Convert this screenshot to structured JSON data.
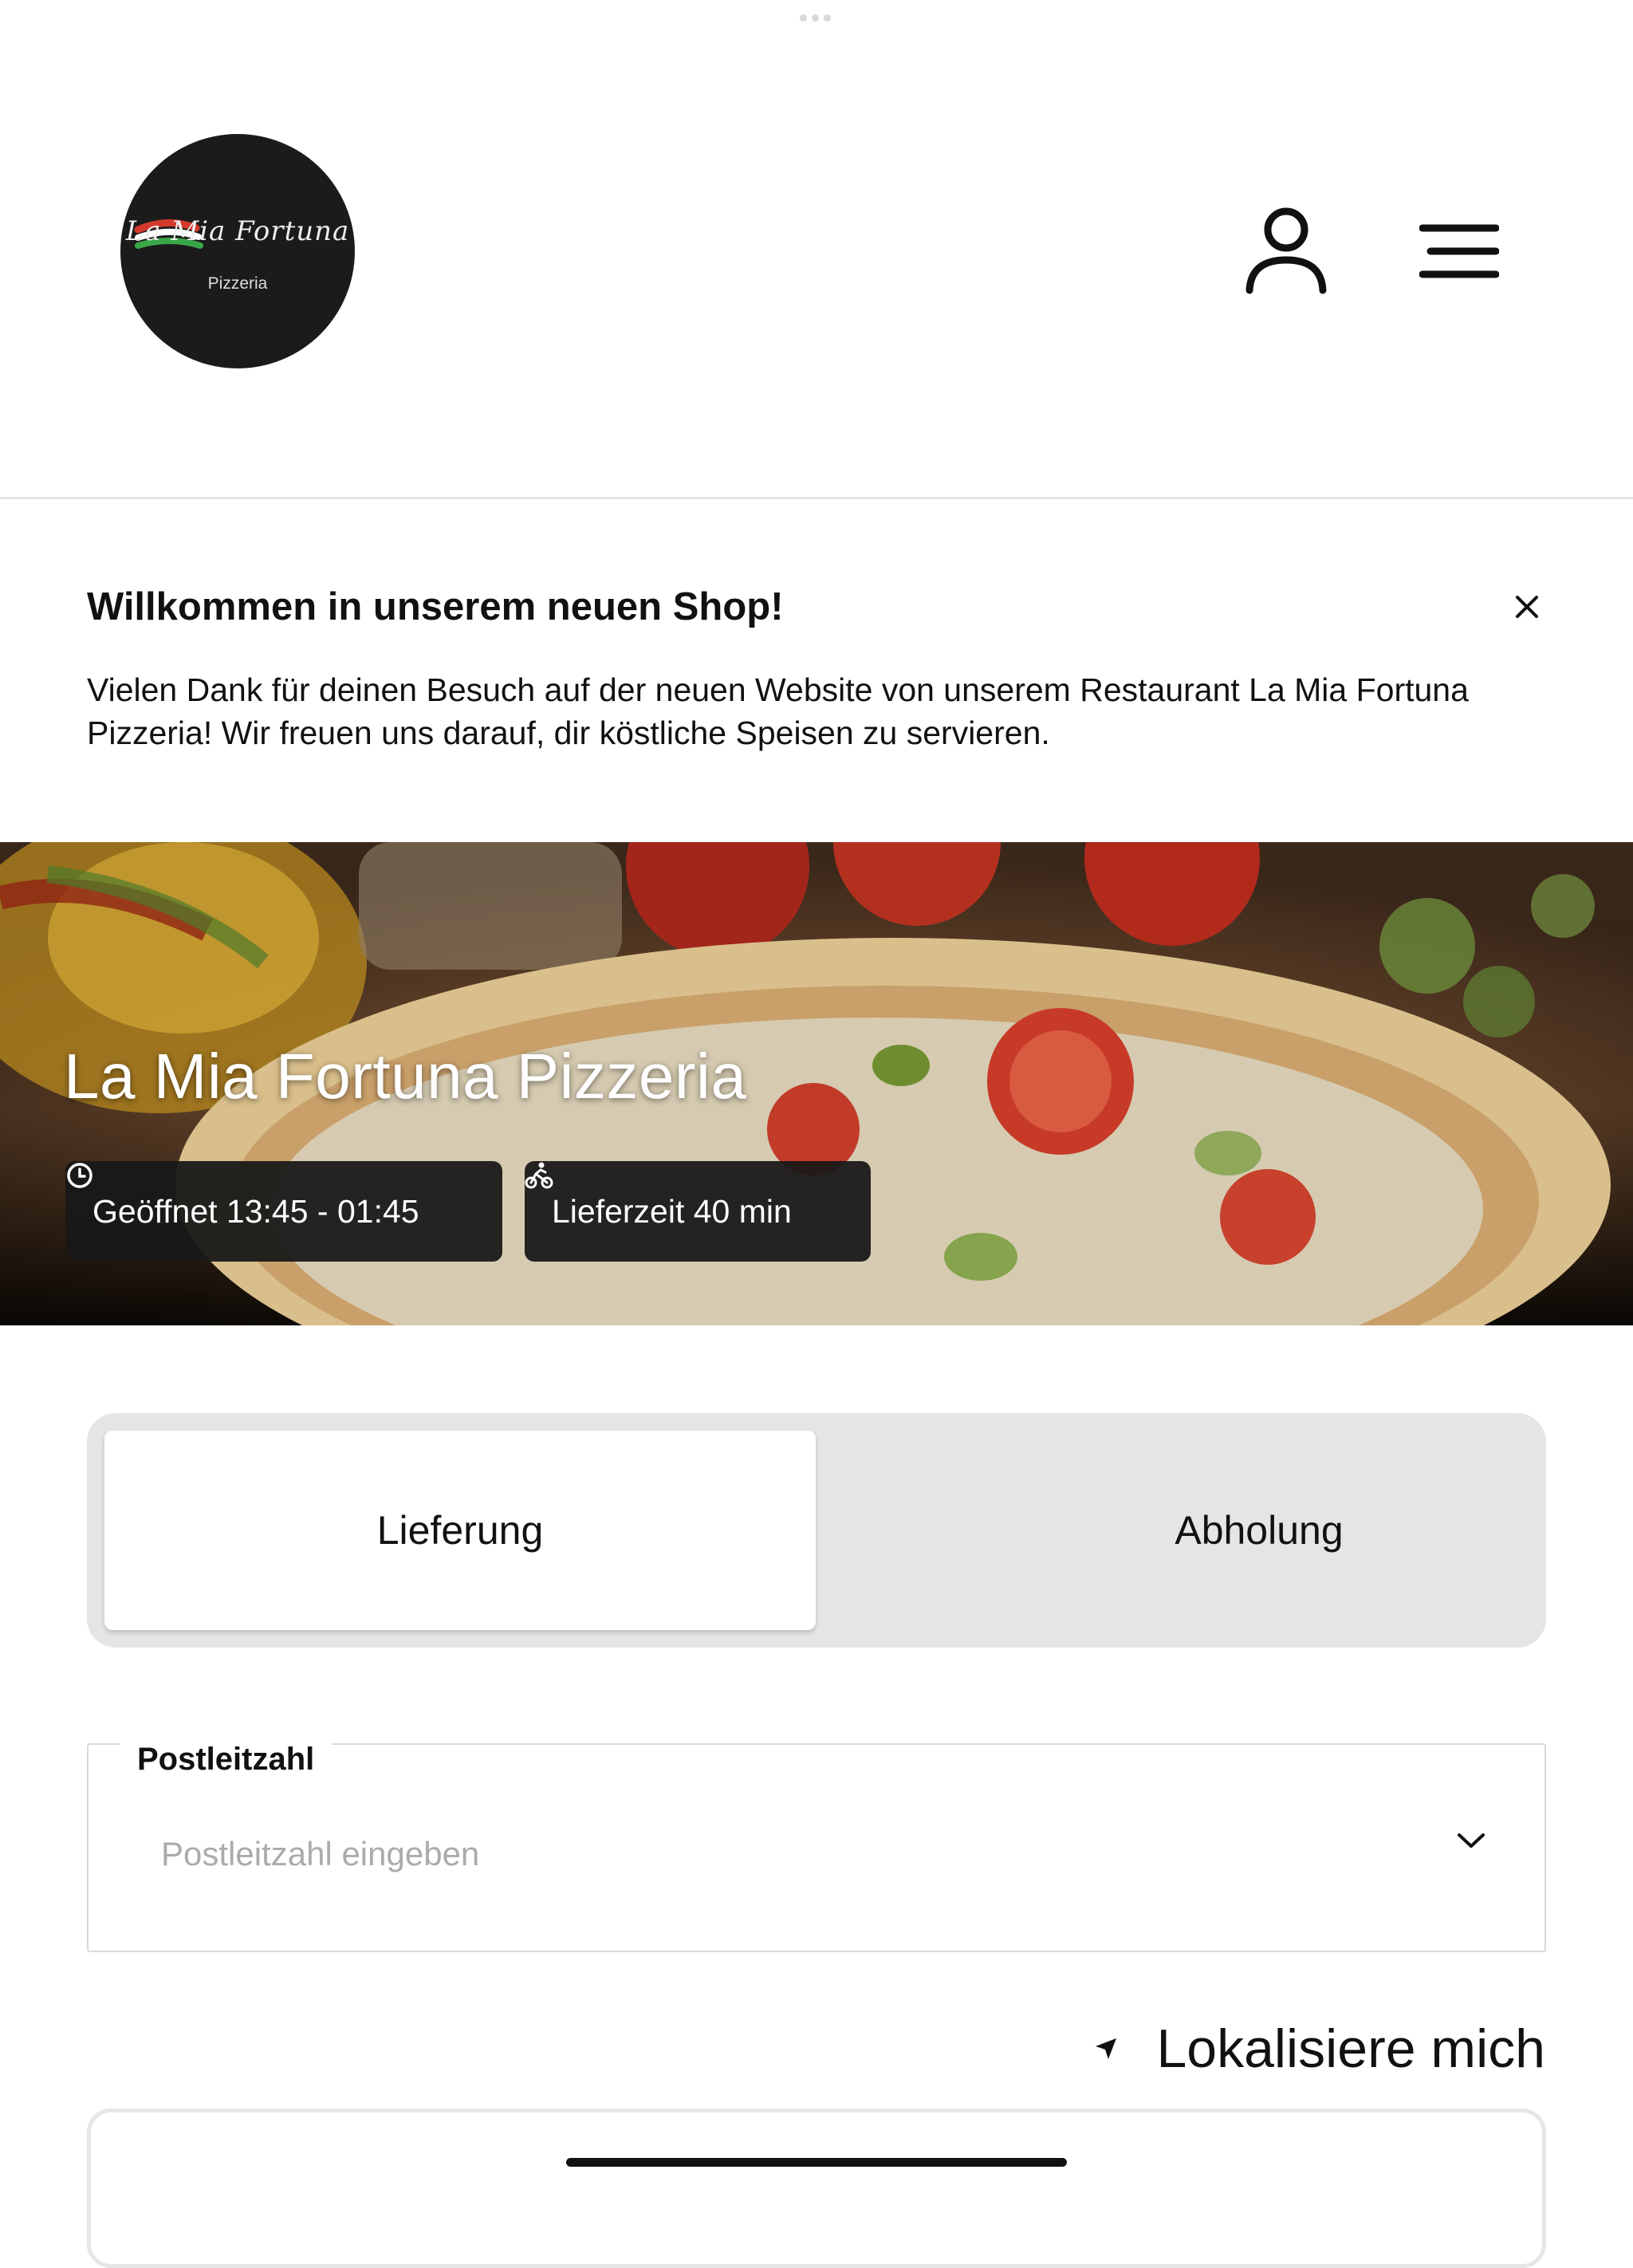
{
  "header": {
    "logo": {
      "script_text": "La Mia Fortuna",
      "sub_text": "Pizzeria",
      "stripe_colors": [
        "#d33a2c",
        "#ffffff",
        "#3aa64a"
      ]
    },
    "user_icon": "user-icon",
    "menu_icon": "hamburger-menu-icon"
  },
  "welcome": {
    "title": "Willkommen in unserem neuen Shop!",
    "text": "Vielen Dank für deinen Besuch auf der neuen Website von unserem Restaurant La Mia Fortuna Pizzeria! Wir freuen uns darauf, dir köstliche Speisen zu servieren.",
    "close_icon": "close-icon"
  },
  "hero": {
    "title": "La Mia Fortuna Pizzeria",
    "open_hours": "Geöffnet 13:45 - 01:45",
    "delivery_time": "Lieferzeit 40 min",
    "open_icon": "clock-icon",
    "delivery_icon": "bicycle-courier-icon"
  },
  "order_mode": {
    "delivery_label": "Lieferung",
    "pickup_label": "Abholung",
    "selected": "Lieferung"
  },
  "zip": {
    "label": "Postleitzahl",
    "placeholder": "Postleitzahl eingeben",
    "value": ""
  },
  "locate": {
    "label": "Lokalisiere mich",
    "icon": "location-arrow-icon"
  },
  "colors": {
    "text": "#111111",
    "chip_bg": "#181818",
    "toggle_bg": "#e5e5e5",
    "placeholder": "#ababab",
    "logo_bg": "#1b1b1b"
  }
}
